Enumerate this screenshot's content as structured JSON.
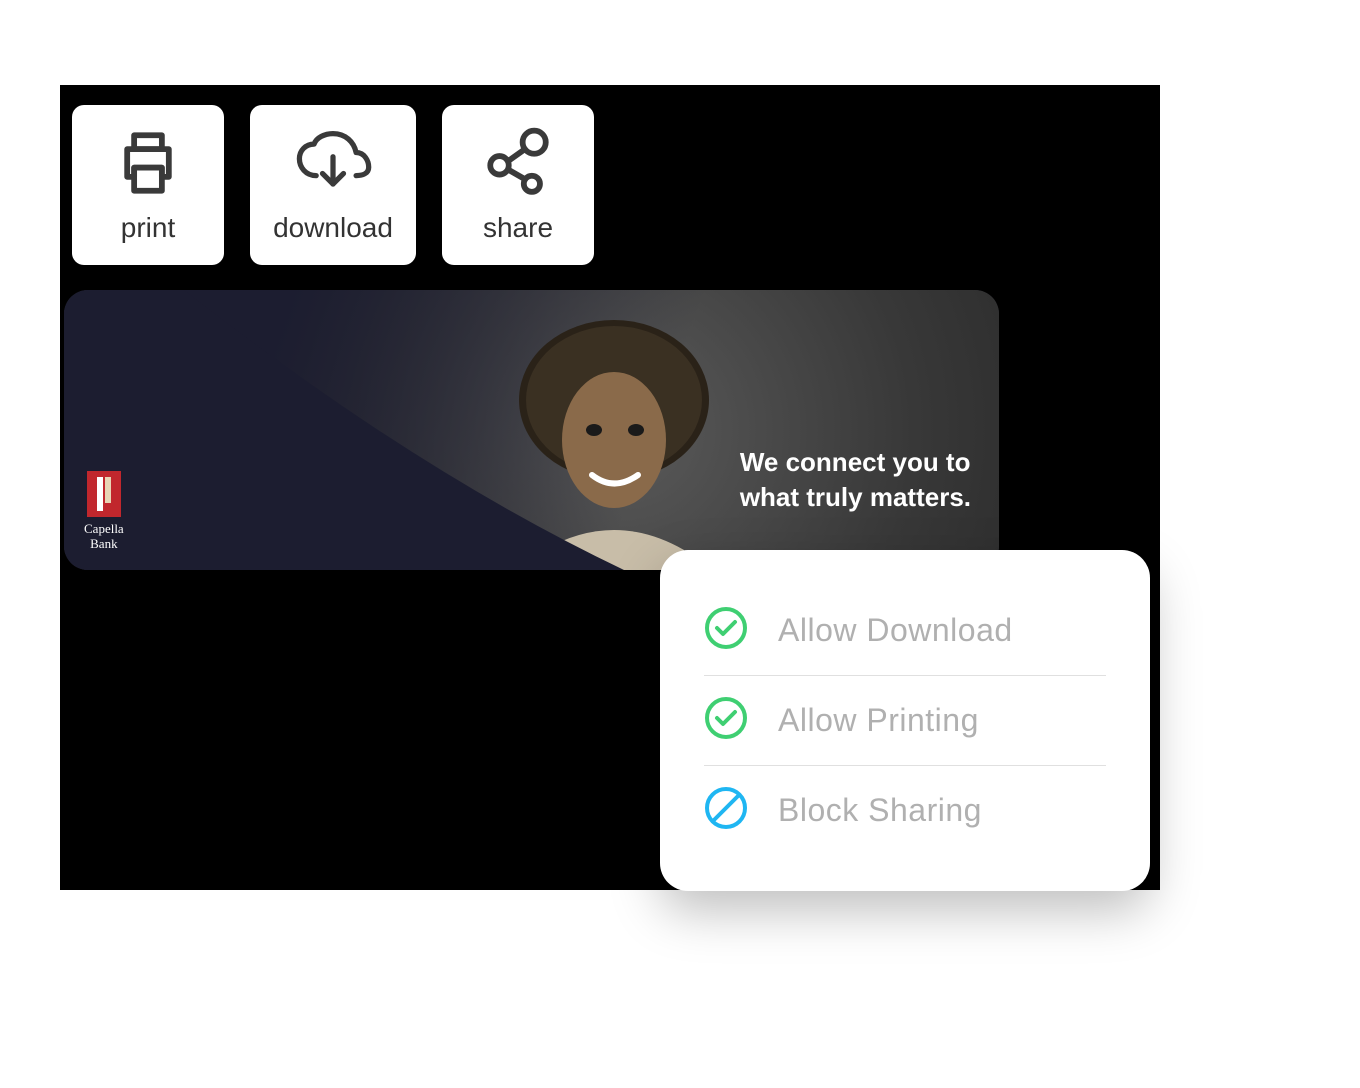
{
  "toolbar": {
    "print_label": "print",
    "download_label": "download",
    "share_label": "share"
  },
  "banner": {
    "brand_name": "Capella\nBank",
    "tagline": "We connect you to\nwhat truly matters."
  },
  "permissions": {
    "items": [
      {
        "label": "Allow Download",
        "state": "allow"
      },
      {
        "label": "Allow Printing",
        "state": "allow"
      },
      {
        "label": "Block Sharing",
        "state": "block"
      }
    ]
  },
  "colors": {
    "allow_green": "#3FCF72",
    "block_blue": "#1FB6F2",
    "icon_stroke": "#3a3a3a"
  }
}
